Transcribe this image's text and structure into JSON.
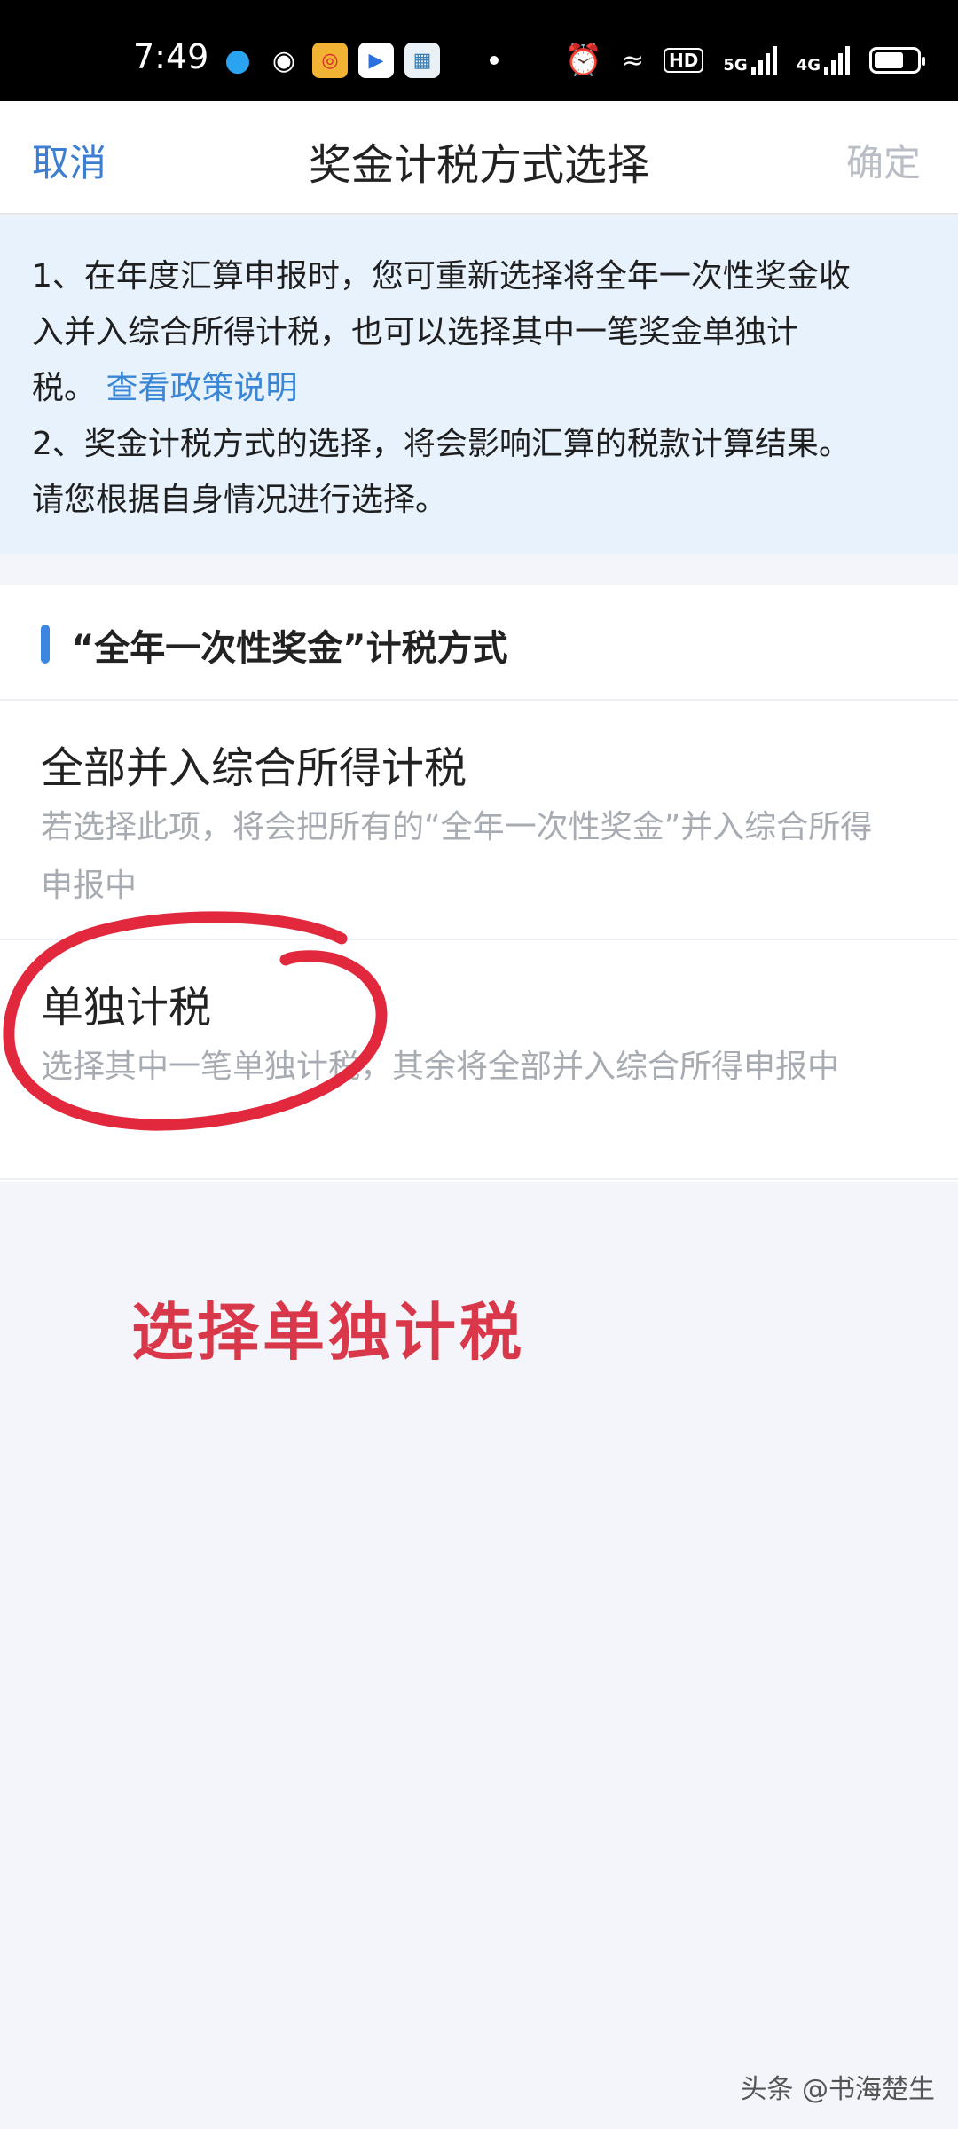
{
  "status_bar": {
    "time": "7:49",
    "network_labels": [
      "5G",
      "4G"
    ],
    "hd_label": "HD"
  },
  "nav": {
    "cancel": "取消",
    "title": "奖金计税方式选择",
    "confirm": "确定"
  },
  "info": {
    "line1": "1、在年度汇算申报时，您可重新选择将全年一次性奖金收",
    "line2": "入并入综合所得计税，也可以选择其中一笔奖金单独计",
    "line3_prefix": "税。",
    "policy_link": "查看政策说明",
    "line4": "2、奖金计税方式的选择，将会影响汇算的税款计算结果。",
    "line5": "请您根据自身情况进行选择。"
  },
  "section": {
    "title": "“全年一次性奖金”计税方式",
    "options": [
      {
        "label": "全部并入综合所得计税",
        "desc": "若选择此项，将会把所有的“全年一次性奖金”并入综合所得申报中"
      },
      {
        "label": "单独计税",
        "desc": "选择其中一笔单独计税，其余将全部并入综合所得申报中"
      }
    ]
  },
  "annotation": {
    "text": "选择单独计税",
    "color": "#d8384a"
  },
  "watermark": "头条 @书海楚生",
  "colors": {
    "accent": "#3b86e0",
    "link": "#3a86d6",
    "disabled": "#b9bec6",
    "info_bg": "#e8f2fd"
  }
}
